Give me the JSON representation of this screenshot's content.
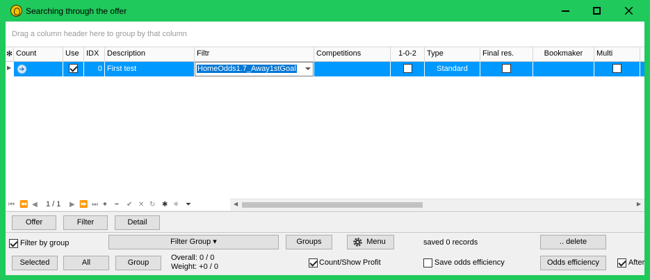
{
  "window": {
    "title": "Searching through the offer"
  },
  "group_panel": {
    "hint": "Drag a column header here to group by that column"
  },
  "grid": {
    "columns": [
      "Count",
      "Use",
      "IDX",
      "Description",
      "Filtr",
      "Competitions",
      "1-0-2",
      "Type",
      "Final res.",
      "Bookmaker",
      "Multi"
    ],
    "rows": [
      {
        "use": true,
        "idx": "0",
        "description": "First test",
        "filtr": "HomeOdds1.7_Away1stGoal",
        "competitions": "",
        "one_zero_two": false,
        "type": "Standard",
        "final_res": false,
        "bookmaker": "",
        "multi": false
      }
    ]
  },
  "navigator": {
    "page_text": "1 / 1"
  },
  "tabs": {
    "offer": "Offer",
    "filter": "Filter",
    "detail": "Detail"
  },
  "row2": {
    "filter_by_group_label": "Filter by group",
    "filter_by_group_checked": true,
    "filter_group_label": "Filter Group ▾",
    "groups_label": "Groups",
    "menu_label": "Menu",
    "saved_text": "saved 0 records",
    "delete_label": ".. delete"
  },
  "row3": {
    "selected_label": "Selected",
    "all_label": "All",
    "group_label": "Group",
    "overall_text": "Overall: 0 / 0",
    "weight_text": "Weight: +0 / 0",
    "count_profit_label": "Count/Show Profit",
    "count_profit_checked": true,
    "save_odds_label": "Save odds efficiency",
    "save_odds_checked": false,
    "odds_efficiency_label": "Odds efficiency",
    "after_label": "After",
    "after_checked": true
  },
  "colors": {
    "title_bar": "#1fc95b",
    "selected_row": "#0099ff"
  }
}
